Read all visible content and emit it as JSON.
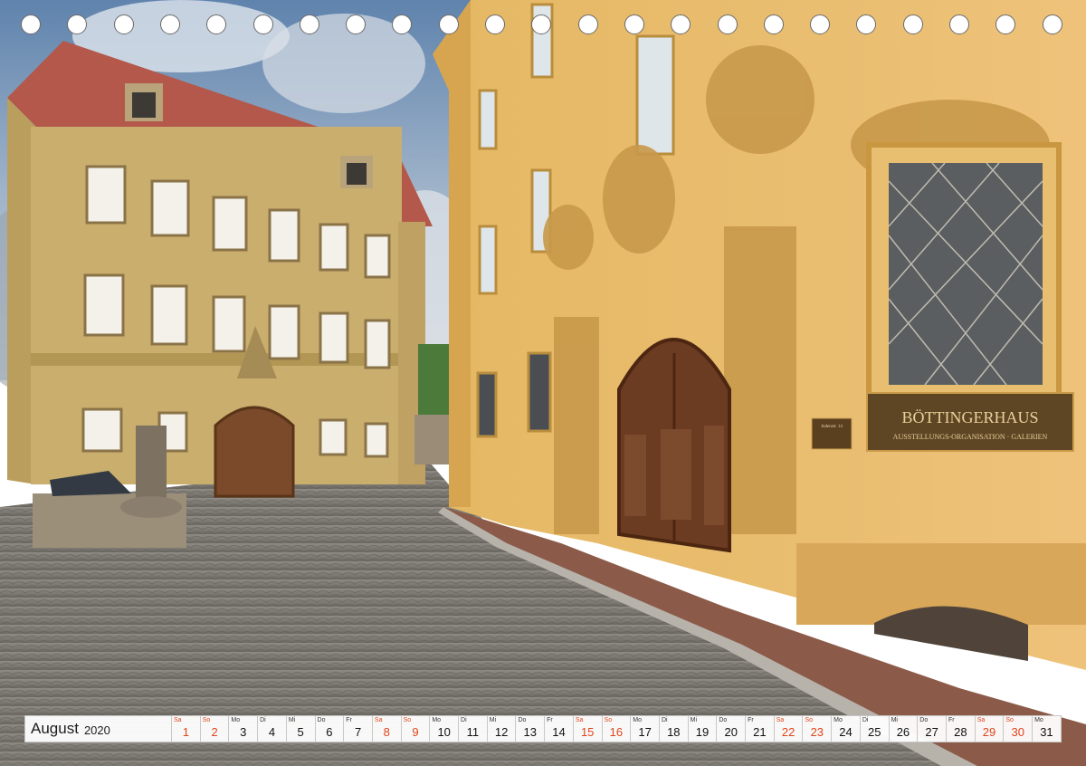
{
  "calendar": {
    "month": "August",
    "year": "2020",
    "days": [
      {
        "wd": "Sa",
        "n": "1",
        "we": true
      },
      {
        "wd": "So",
        "n": "2",
        "we": true
      },
      {
        "wd": "Mo",
        "n": "3",
        "we": false
      },
      {
        "wd": "Di",
        "n": "4",
        "we": false
      },
      {
        "wd": "Mi",
        "n": "5",
        "we": false
      },
      {
        "wd": "Do",
        "n": "6",
        "we": false
      },
      {
        "wd": "Fr",
        "n": "7",
        "we": false
      },
      {
        "wd": "Sa",
        "n": "8",
        "we": true
      },
      {
        "wd": "So",
        "n": "9",
        "we": true
      },
      {
        "wd": "Mo",
        "n": "10",
        "we": false
      },
      {
        "wd": "Di",
        "n": "11",
        "we": false
      },
      {
        "wd": "Mi",
        "n": "12",
        "we": false
      },
      {
        "wd": "Do",
        "n": "13",
        "we": false
      },
      {
        "wd": "Fr",
        "n": "14",
        "we": false
      },
      {
        "wd": "Sa",
        "n": "15",
        "we": true
      },
      {
        "wd": "So",
        "n": "16",
        "we": true
      },
      {
        "wd": "Mo",
        "n": "17",
        "we": false
      },
      {
        "wd": "Di",
        "n": "18",
        "we": false
      },
      {
        "wd": "Mi",
        "n": "19",
        "we": false
      },
      {
        "wd": "Do",
        "n": "20",
        "we": false
      },
      {
        "wd": "Fr",
        "n": "21",
        "we": false
      },
      {
        "wd": "Sa",
        "n": "22",
        "we": true
      },
      {
        "wd": "So",
        "n": "23",
        "we": true
      },
      {
        "wd": "Mo",
        "n": "24",
        "we": false
      },
      {
        "wd": "Di",
        "n": "25",
        "we": false
      },
      {
        "wd": "Mi",
        "n": "26",
        "we": false
      },
      {
        "wd": "Do",
        "n": "27",
        "we": false
      },
      {
        "wd": "Fr",
        "n": "28",
        "we": false
      },
      {
        "wd": "Sa",
        "n": "29",
        "we": true
      },
      {
        "wd": "So",
        "n": "30",
        "we": true
      },
      {
        "wd": "Mo",
        "n": "31",
        "we": false
      }
    ]
  },
  "photo": {
    "sign_title": "BÖTTINGERHAUS",
    "sign_subtitle": "AUSSTELLUNGS-ORGANISATION · GALERIEN",
    "plaque": "Judenstr. 14"
  },
  "colors": {
    "weekend": "#e0441b",
    "facade": "#e2b45e",
    "sky": "#6d8fb3"
  }
}
